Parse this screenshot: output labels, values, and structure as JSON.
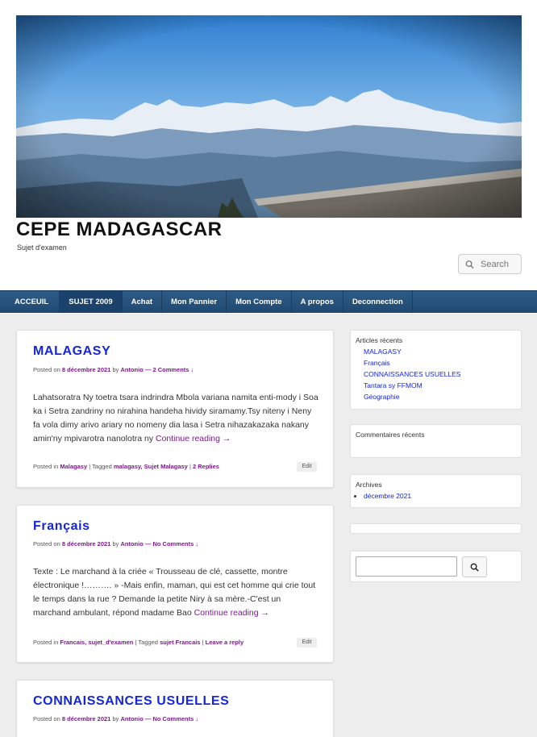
{
  "site": {
    "title": "CEPE MADAGASCAR",
    "description": "Sujet d'examen"
  },
  "search": {
    "placeholder": "Search"
  },
  "nav": {
    "items": [
      "ACCEUIL",
      "SUJET 2009",
      "Achat",
      "Mon Pannier",
      "Mon Compte",
      "A propos",
      "Deconnection"
    ],
    "active": "SUJET 2009"
  },
  "posts": [
    {
      "title": "MALAGASY",
      "meta_prefix": "Posted on",
      "date": "8 décembre 2021",
      "by": "by",
      "author": "Antonio",
      "comments_link": "— 2 Comments ↓",
      "excerpt": "Lahatsoratra Ny toetra tsara indrindra Mbola variana namita enti-mody i Soa ka i Setra zandriny no nirahina handeha hividy siramamy.Tsy niteny i Neny fa vola dimy arivo ariary no nomeny dia lasa i Setra nihazakazaka nakany amin'ny mpivarotra nanolotra ny",
      "continue": "Continue reading →",
      "posted_in": "Posted in",
      "categories": "Malagasy",
      "tagged": "| Tagged",
      "tags": "malagasy, Sujet Malagasy",
      "reply_link": "2 Replies",
      "edit": "Edit"
    },
    {
      "title": "Français",
      "meta_prefix": "Posted on",
      "date": "8 décembre 2021",
      "by": "by",
      "author": "Antonio",
      "comments_link": "— No Comments ↓",
      "excerpt": "Texte : Le marchand à la  criée « Trousseau de clé, cassette, montre électronique !………. » -Mais enfin, maman, qui est cet homme qui crie tout le temps dans la rue ? Demande la petite Niry à sa mère.-C'est un marchand ambulant, répond madame Bao",
      "continue": "Continue reading →",
      "posted_in": "Posted in",
      "categories": "Francais, sujet_d'examen",
      "tagged": "| Tagged",
      "tags": "sujet Francais",
      "reply_link": "Leave a reply",
      "edit": "Edit"
    },
    {
      "title": "CONNAISSANCES USUELLES",
      "meta_prefix": "Posted on",
      "date": "8 décembre 2021",
      "by": "by",
      "author": "Antonio",
      "comments_link": "— No Comments ↓"
    }
  ],
  "sidebar": {
    "recent_posts": {
      "title": "Articles récents",
      "items": [
        "MALAGASY",
        "Français",
        "CONNAISSANCES USUELLES",
        "Tantara sy FFMOM",
        "Géographie"
      ]
    },
    "recent_comments": {
      "title": "Commentaires récents"
    },
    "archives": {
      "title": "Archives",
      "items": [
        "décembre 2021"
      ]
    }
  },
  "colors": {
    "link_blue": "#1526d6",
    "link_purple": "#7b1a8c",
    "nav_bg": "#24507a"
  }
}
